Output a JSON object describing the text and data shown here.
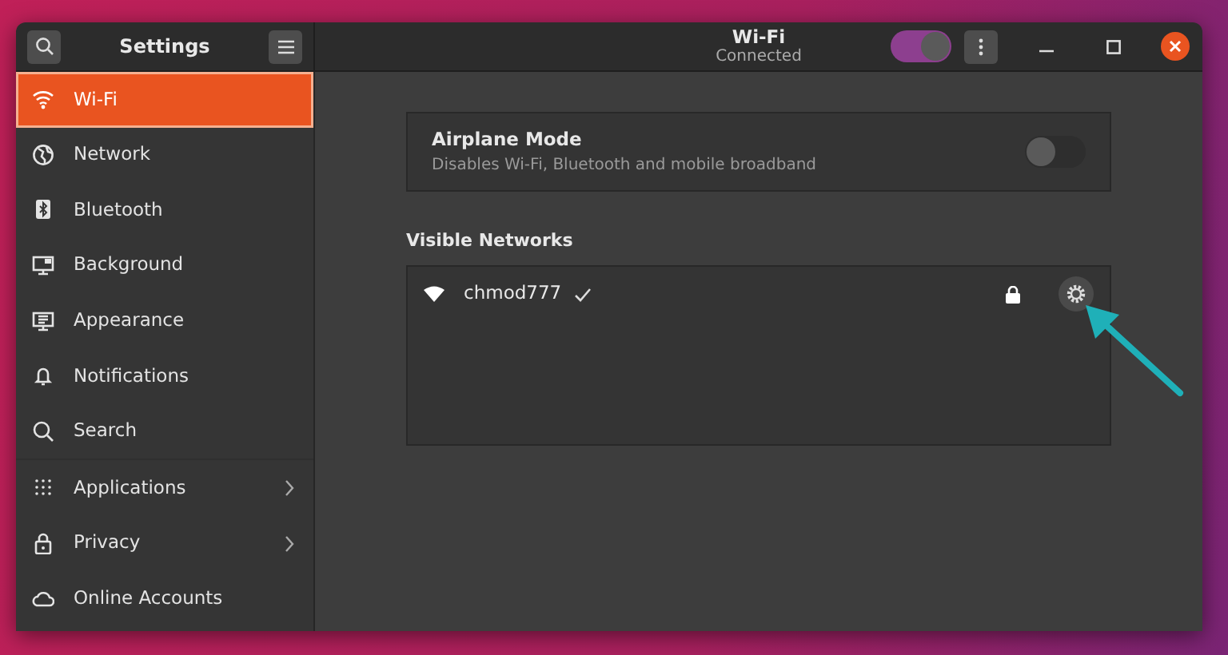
{
  "sidebar": {
    "title": "Settings",
    "groups": [
      [
        {
          "label": "Wi-Fi",
          "selected": true,
          "chevron": false
        },
        {
          "label": "Network",
          "selected": false,
          "chevron": false
        },
        {
          "label": "Bluetooth",
          "selected": false,
          "chevron": false
        },
        {
          "label": "Background",
          "selected": false,
          "chevron": false
        },
        {
          "label": "Appearance",
          "selected": false,
          "chevron": false
        },
        {
          "label": "Notifications",
          "selected": false,
          "chevron": false
        },
        {
          "label": "Search",
          "selected": false,
          "chevron": false
        }
      ],
      [
        {
          "label": "Applications",
          "selected": false,
          "chevron": true
        },
        {
          "label": "Privacy",
          "selected": false,
          "chevron": true
        },
        {
          "label": "Online Accounts",
          "selected": false,
          "chevron": false
        }
      ]
    ]
  },
  "header": {
    "title": "Wi-Fi",
    "subtitle": "Connected",
    "wifi_on": true
  },
  "airplane": {
    "title": "Airplane Mode",
    "description": "Disables Wi-Fi, Bluetooth and mobile broadband",
    "on": false
  },
  "networks": {
    "heading": "Visible Networks",
    "items": [
      {
        "name": "chmod777",
        "connected": true,
        "secured": true
      }
    ]
  }
}
